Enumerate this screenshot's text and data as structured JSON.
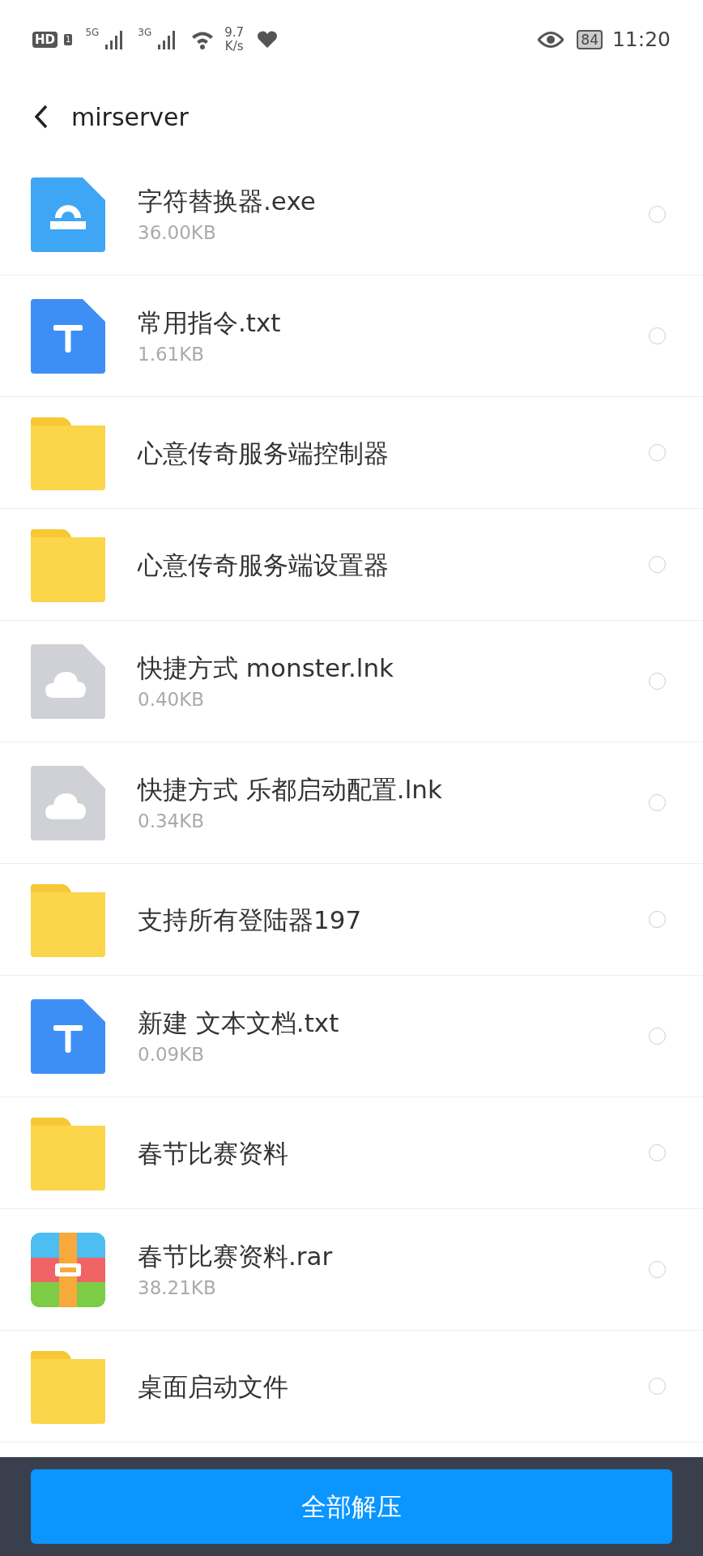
{
  "status_bar": {
    "hd": "HD",
    "sim": "1",
    "net1": "5G",
    "net2": "3G",
    "speed": "9.7",
    "speed_unit": "K/s",
    "battery": "84",
    "time": "11:20"
  },
  "header": {
    "title": "mirserver"
  },
  "files": [
    {
      "kind": "exe",
      "name": "字符替换器.exe",
      "size": "36.00KB",
      "selected": false
    },
    {
      "kind": "txt",
      "name": "常用指令.txt",
      "size": "1.61KB",
      "selected": false
    },
    {
      "kind": "folder",
      "name": "心意传奇服务端控制器",
      "selected": false
    },
    {
      "kind": "folder",
      "name": "心意传奇服务端设置器",
      "selected": false
    },
    {
      "kind": "lnk",
      "name": "快捷方式 monster.lnk",
      "size": "0.40KB",
      "selected": false
    },
    {
      "kind": "lnk",
      "name": "快捷方式 乐都启动配置.lnk",
      "size": "0.34KB",
      "selected": false
    },
    {
      "kind": "folder",
      "name": "支持所有登陆器197",
      "selected": false
    },
    {
      "kind": "txt",
      "name": "新建 文本文档.txt",
      "size": "0.09KB",
      "selected": false
    },
    {
      "kind": "folder",
      "name": "春节比赛资料",
      "selected": false
    },
    {
      "kind": "rar",
      "name": "春节比赛资料.rar",
      "size": "38.21KB",
      "selected": false
    },
    {
      "kind": "folder",
      "name": "桌面启动文件",
      "selected": false
    }
  ],
  "footer": {
    "button": "全部解压"
  }
}
